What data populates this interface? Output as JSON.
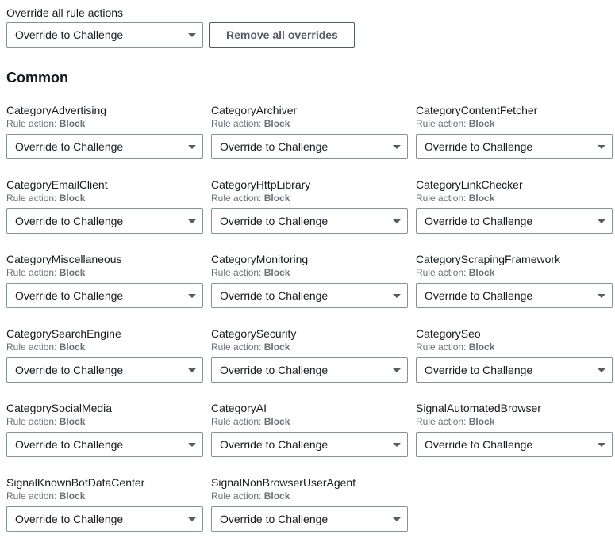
{
  "override_all_label": "Override all rule actions",
  "override_all_value": "Override to Challenge",
  "remove_all_label": "Remove all overrides",
  "section_title": "Common",
  "rule_action_prefix": "Rule action: ",
  "rules": [
    {
      "name": "CategoryAdvertising",
      "action": "Block",
      "override": "Override to Challenge"
    },
    {
      "name": "CategoryArchiver",
      "action": "Block",
      "override": "Override to Challenge"
    },
    {
      "name": "CategoryContentFetcher",
      "action": "Block",
      "override": "Override to Challenge"
    },
    {
      "name": "CategoryEmailClient",
      "action": "Block",
      "override": "Override to Challenge"
    },
    {
      "name": "CategoryHttpLibrary",
      "action": "Block",
      "override": "Override to Challenge"
    },
    {
      "name": "CategoryLinkChecker",
      "action": "Block",
      "override": "Override to Challenge"
    },
    {
      "name": "CategoryMiscellaneous",
      "action": "Block",
      "override": "Override to Challenge"
    },
    {
      "name": "CategoryMonitoring",
      "action": "Block",
      "override": "Override to Challenge"
    },
    {
      "name": "CategoryScrapingFramework",
      "action": "Block",
      "override": "Override to Challenge"
    },
    {
      "name": "CategorySearchEngine",
      "action": "Block",
      "override": "Override to Challenge"
    },
    {
      "name": "CategorySecurity",
      "action": "Block",
      "override": "Override to Challenge"
    },
    {
      "name": "CategorySeo",
      "action": "Block",
      "override": "Override to Challenge"
    },
    {
      "name": "CategorySocialMedia",
      "action": "Block",
      "override": "Override to Challenge"
    },
    {
      "name": "CategoryAI",
      "action": "Block",
      "override": "Override to Challenge"
    },
    {
      "name": "SignalAutomatedBrowser",
      "action": "Block",
      "override": "Override to Challenge"
    },
    {
      "name": "SignalKnownBotDataCenter",
      "action": "Block",
      "override": "Override to Challenge"
    },
    {
      "name": "SignalNonBrowserUserAgent",
      "action": "Block",
      "override": "Override to Challenge"
    }
  ]
}
